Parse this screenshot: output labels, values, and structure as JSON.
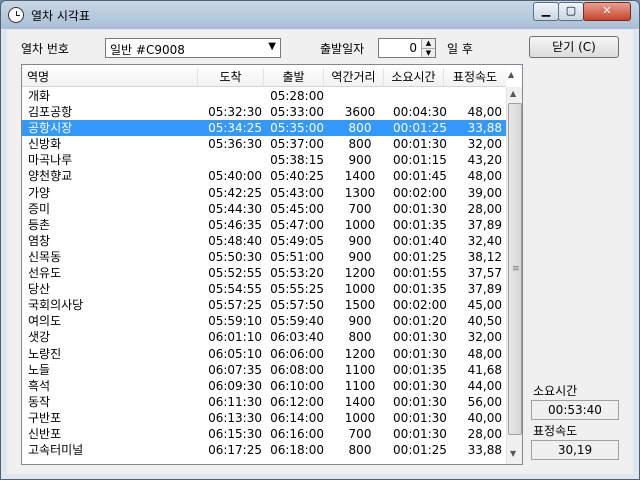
{
  "window": {
    "title": "열차 시각표"
  },
  "titlebar": {
    "minimize": "▁",
    "maximize": "▢",
    "close": "✕"
  },
  "form": {
    "train_label": "열차 번호",
    "train_value": "일반 #C9008",
    "date_label": "출발일자",
    "date_offset": "0",
    "date_suffix": "일 후",
    "close_button": "닫기 (C)"
  },
  "table": {
    "columns": [
      "역명",
      "도착",
      "출발",
      "역간거리",
      "소요시간",
      "표정속도"
    ],
    "rows": [
      {
        "name": "개화",
        "arrive": "",
        "depart": "05:28:00",
        "dist": "",
        "time": "",
        "speed": ""
      },
      {
        "name": "김포공항",
        "arrive": "05:32:30",
        "depart": "05:33:00",
        "dist": "3600",
        "time": "00:04:30",
        "speed": "48,00"
      },
      {
        "name": "공항시장",
        "arrive": "05:34:25",
        "depart": "05:35:00",
        "dist": "800",
        "time": "00:01:25",
        "speed": "33,88"
      },
      {
        "name": "신방화",
        "arrive": "05:36:30",
        "depart": "05:37:00",
        "dist": "800",
        "time": "00:01:30",
        "speed": "32,00"
      },
      {
        "name": "마곡나루",
        "arrive": "",
        "depart": "05:38:15",
        "dist": "900",
        "time": "00:01:15",
        "speed": "43,20"
      },
      {
        "name": "양천향교",
        "arrive": "05:40:00",
        "depart": "05:40:25",
        "dist": "1400",
        "time": "00:01:45",
        "speed": "48,00"
      },
      {
        "name": "가양",
        "arrive": "05:42:25",
        "depart": "05:43:00",
        "dist": "1300",
        "time": "00:02:00",
        "speed": "39,00"
      },
      {
        "name": "증미",
        "arrive": "05:44:30",
        "depart": "05:45:00",
        "dist": "700",
        "time": "00:01:30",
        "speed": "28,00"
      },
      {
        "name": "등촌",
        "arrive": "05:46:35",
        "depart": "05:47:00",
        "dist": "1000",
        "time": "00:01:35",
        "speed": "37,89"
      },
      {
        "name": "염창",
        "arrive": "05:48:40",
        "depart": "05:49:05",
        "dist": "900",
        "time": "00:01:40",
        "speed": "32,40"
      },
      {
        "name": "신목동",
        "arrive": "05:50:30",
        "depart": "05:51:00",
        "dist": "900",
        "time": "00:01:25",
        "speed": "38,12"
      },
      {
        "name": "선유도",
        "arrive": "05:52:55",
        "depart": "05:53:20",
        "dist": "1200",
        "time": "00:01:55",
        "speed": "37,57"
      },
      {
        "name": "당산",
        "arrive": "05:54:55",
        "depart": "05:55:25",
        "dist": "1000",
        "time": "00:01:35",
        "speed": "37,89"
      },
      {
        "name": "국회의사당",
        "arrive": "05:57:25",
        "depart": "05:57:50",
        "dist": "1500",
        "time": "00:02:00",
        "speed": "45,00"
      },
      {
        "name": "여의도",
        "arrive": "05:59:10",
        "depart": "05:59:40",
        "dist": "900",
        "time": "00:01:20",
        "speed": "40,50"
      },
      {
        "name": "샛강",
        "arrive": "06:01:10",
        "depart": "06:03:40",
        "dist": "800",
        "time": "00:01:30",
        "speed": "32,00"
      },
      {
        "name": "노량진",
        "arrive": "06:05:10",
        "depart": "06:06:00",
        "dist": "1200",
        "time": "00:01:30",
        "speed": "48,00"
      },
      {
        "name": "노들",
        "arrive": "06:07:35",
        "depart": "06:08:00",
        "dist": "1100",
        "time": "00:01:35",
        "speed": "41,68"
      },
      {
        "name": "흑석",
        "arrive": "06:09:30",
        "depart": "06:10:00",
        "dist": "1100",
        "time": "00:01:30",
        "speed": "44,00"
      },
      {
        "name": "동작",
        "arrive": "06:11:30",
        "depart": "06:12:00",
        "dist": "1400",
        "time": "00:01:30",
        "speed": "56,00"
      },
      {
        "name": "구반포",
        "arrive": "06:13:30",
        "depart": "06:14:00",
        "dist": "1000",
        "time": "00:01:30",
        "speed": "40,00"
      },
      {
        "name": "신반포",
        "arrive": "06:15:30",
        "depart": "06:16:00",
        "dist": "700",
        "time": "00:01:30",
        "speed": "28,00"
      },
      {
        "name": "고속터미널",
        "arrive": "06:17:25",
        "depart": "06:18:00",
        "dist": "800",
        "time": "00:01:25",
        "speed": "33,88"
      }
    ],
    "selected_index": 2
  },
  "summary": {
    "duration_label": "소요시간",
    "duration_value": "00:53:40",
    "speed_label": "표정속도",
    "speed_value": "30,19"
  },
  "icons": {
    "sort": "▲",
    "scroll_up": "▲",
    "scroll_down": "▼",
    "grip": "≡",
    "dropdown": "▼"
  }
}
